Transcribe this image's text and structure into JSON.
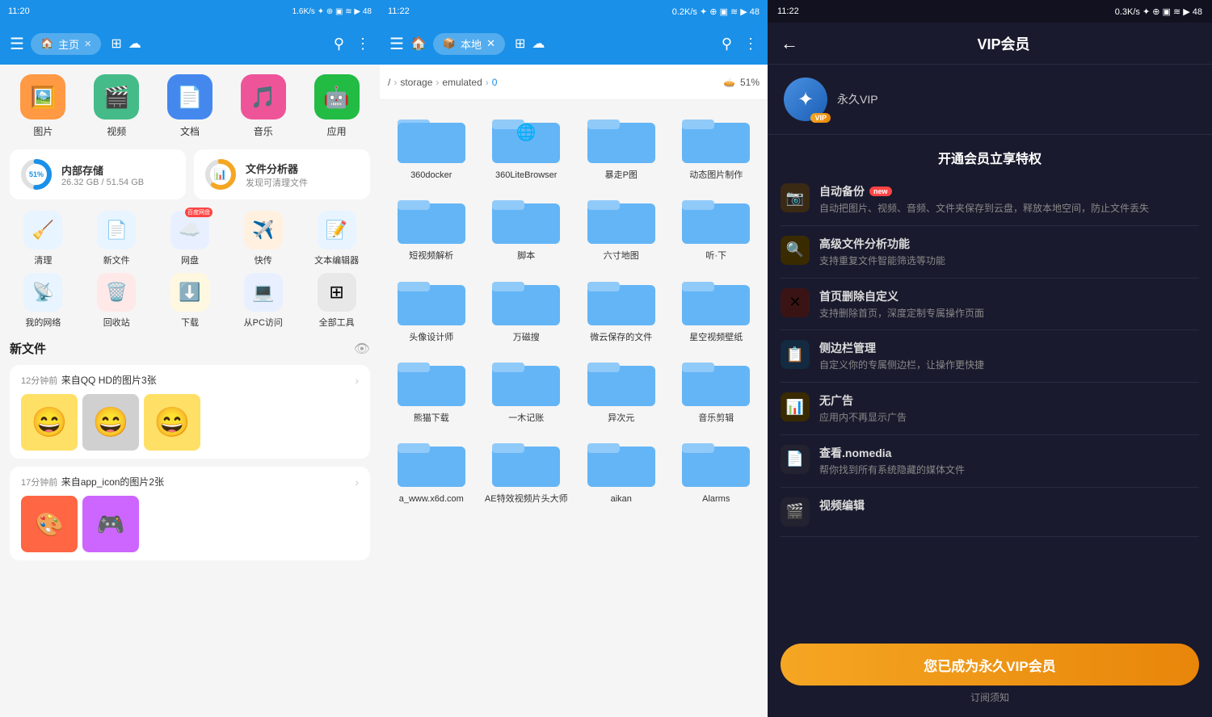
{
  "panel1": {
    "status_bar": {
      "time": "11:20",
      "right": "...1.6K/s ✦ ₿ ☐ ↑↓ ◀ ▶ 48"
    },
    "top_bar": {
      "menu_icon": "☰",
      "tab_icon": "🏠",
      "tab_label": "主页",
      "close_icon": "✕",
      "search_icon": "⚲",
      "more_icon": "⋮"
    },
    "categories": [
      {
        "id": "images",
        "icon": "🖼️",
        "color": "#ff9944",
        "label": "图片"
      },
      {
        "id": "video",
        "icon": "▶️",
        "color": "#44bb88",
        "label": "视频"
      },
      {
        "id": "docs",
        "icon": "📄",
        "color": "#4488ee",
        "label": "文档"
      },
      {
        "id": "music",
        "icon": "🎵",
        "color": "#ee5599",
        "label": "音乐"
      },
      {
        "id": "apps",
        "icon": "🤖",
        "color": "#22bb44",
        "label": "应用"
      }
    ],
    "storage": {
      "internal": {
        "percent": 51,
        "label": "51%",
        "title": "内部存储",
        "sub": "26.32 GB / 51.54 GB"
      },
      "analyzer": {
        "icon": "📊",
        "title": "文件分析器",
        "sub": "发现可清理文件"
      }
    },
    "tools": [
      {
        "id": "clean",
        "icon": "🧹",
        "color": "#eef",
        "label": "清理",
        "badge": ""
      },
      {
        "id": "newfile",
        "icon": "📄",
        "color": "#eef",
        "label": "新文件",
        "badge": ""
      },
      {
        "id": "cloud",
        "icon": "☁️",
        "color": "#eef",
        "label": "网盘",
        "badge": "百度网盘"
      },
      {
        "id": "transfer",
        "icon": "✈️",
        "color": "#eef",
        "label": "快传",
        "badge": ""
      },
      {
        "id": "editor",
        "icon": "📝",
        "color": "#eef",
        "label": "文本编辑器",
        "badge": ""
      },
      {
        "id": "network",
        "icon": "📡",
        "color": "#eef",
        "label": "我的网络",
        "badge": ""
      },
      {
        "id": "trash",
        "icon": "🗑️",
        "color": "#eef",
        "label": "回收站",
        "badge": ""
      },
      {
        "id": "download",
        "icon": "⬇️",
        "color": "#eef",
        "label": "下载",
        "badge": ""
      },
      {
        "id": "pc",
        "icon": "💻",
        "color": "#eef",
        "label": "从PC访问",
        "badge": ""
      },
      {
        "id": "all",
        "icon": "⊞",
        "color": "#eef",
        "label": "全部工具",
        "badge": ""
      }
    ],
    "new_files": {
      "title": "新文件",
      "groups": [
        {
          "time": "12分钟前",
          "source": "来自QQ HD的图片3张",
          "thumbs": [
            "😄",
            "😄",
            "😄"
          ]
        },
        {
          "time": "17分钟前",
          "source": "来自app_icon的图片2张",
          "thumbs": [
            "🎨"
          ]
        }
      ]
    }
  },
  "panel2": {
    "status_bar": {
      "time": "11:22",
      "right": "...0.2K/s ✦ ₿ ☐ ↑↓ ◀ ▶ 48"
    },
    "top_bar": {
      "menu_icon": "☰",
      "home_icon": "🏠",
      "tab_icon": "📦",
      "tab_label": "本地",
      "close_icon": "✕",
      "search_icon": "⚲",
      "more_icon": "⋮"
    },
    "breadcrumb": {
      "items": [
        "/",
        "storage",
        "emulated",
        "0"
      ],
      "storage_percent": "51%"
    },
    "folders": [
      {
        "id": "360docker",
        "label": "360docker",
        "has_inner": false
      },
      {
        "id": "360litebrowser",
        "label": "360LiteBrowser",
        "has_inner": true,
        "inner_icon": "🌐"
      },
      {
        "id": "baopaotu",
        "label": "暴走P图",
        "has_inner": false
      },
      {
        "id": "dongtaitu",
        "label": "动态图片制作",
        "has_inner": false
      },
      {
        "id": "shortvideo",
        "label": "短视频解析",
        "has_inner": false
      },
      {
        "id": "script",
        "label": "脚本",
        "has_inner": false
      },
      {
        "id": "sixmap",
        "label": "六寸地图",
        "has_inner": false
      },
      {
        "id": "tingxia",
        "label": "听·下",
        "has_inner": false
      },
      {
        "id": "head",
        "label": "头像设计师",
        "has_inner": false
      },
      {
        "id": "wancisou",
        "label": "万磁搜",
        "has_inner": false
      },
      {
        "id": "weiyun",
        "label": "微云保存的文件",
        "has_inner": false
      },
      {
        "id": "xingkong",
        "label": "星空视频壁纸",
        "has_inner": false
      },
      {
        "id": "panda",
        "label": "熊猫下载",
        "has_inner": false
      },
      {
        "id": "yimu",
        "label": "一木记账",
        "has_inner": false
      },
      {
        "id": "yiciyuan",
        "label": "异次元",
        "has_inner": false
      },
      {
        "id": "musiccut",
        "label": "音乐剪辑",
        "has_inner": false
      },
      {
        "id": "awww",
        "label": "a_www.x6d.com",
        "has_inner": false
      },
      {
        "id": "ae",
        "label": "AE特效视频片头大师",
        "has_inner": false
      },
      {
        "id": "aikan",
        "label": "aikan",
        "has_inner": false
      },
      {
        "id": "alarms",
        "label": "Alarms",
        "has_inner": false
      }
    ]
  },
  "panel3": {
    "status_bar": {
      "time": "11:22",
      "right": "...0.3K/s ✦ ₿ ☐ ↑↓ ◀ ▶ 48"
    },
    "title": "VIP会员",
    "back_icon": "←",
    "profile": {
      "avatar_icon": "✦",
      "vip_badge": "VIP",
      "username": "永久VIP"
    },
    "section_title": "开通会员立享特权",
    "features": [
      {
        "id": "auto-backup",
        "icon": "📷",
        "icon_color": "#8B6914",
        "title": "自动备份",
        "is_new": true,
        "desc": "自动把图片、视频、音频、文件夹保存到云盘，释放本地空间，防止文件丢失"
      },
      {
        "id": "advanced-analysis",
        "icon": "🔍",
        "icon_color": "#e8860a",
        "title": "高级文件分析功能",
        "is_new": false,
        "desc": "支持重复文件智能筛选等功能"
      },
      {
        "id": "home-customize",
        "icon": "✕",
        "icon_color": "#cc4444",
        "title": "首页删除自定义",
        "is_new": false,
        "desc": "支持删除首页，深度定制专属操作页面"
      },
      {
        "id": "sidebar",
        "icon": "📋",
        "icon_color": "#4a90e2",
        "title": "侧边栏管理",
        "is_new": false,
        "desc": "自定义你的专属侧边栏，让操作更快捷"
      },
      {
        "id": "no-ads",
        "icon": "📈",
        "icon_color": "#e8a020",
        "title": "无广告",
        "is_new": false,
        "desc": "应用内不再显示广告"
      },
      {
        "id": "nomedia",
        "icon": "📄",
        "icon_color": "#555",
        "title": "查看.nomedia",
        "is_new": false,
        "desc": "帮你找到所有系统隐藏的媒体文件"
      },
      {
        "id": "video-edit",
        "icon": "🎬",
        "icon_color": "#555",
        "title": "视频编辑",
        "is_new": false,
        "desc": ""
      }
    ],
    "cta_button": "您已成为永久VIP会员",
    "sub_text": "订阅须知",
    "new_label": "new"
  }
}
